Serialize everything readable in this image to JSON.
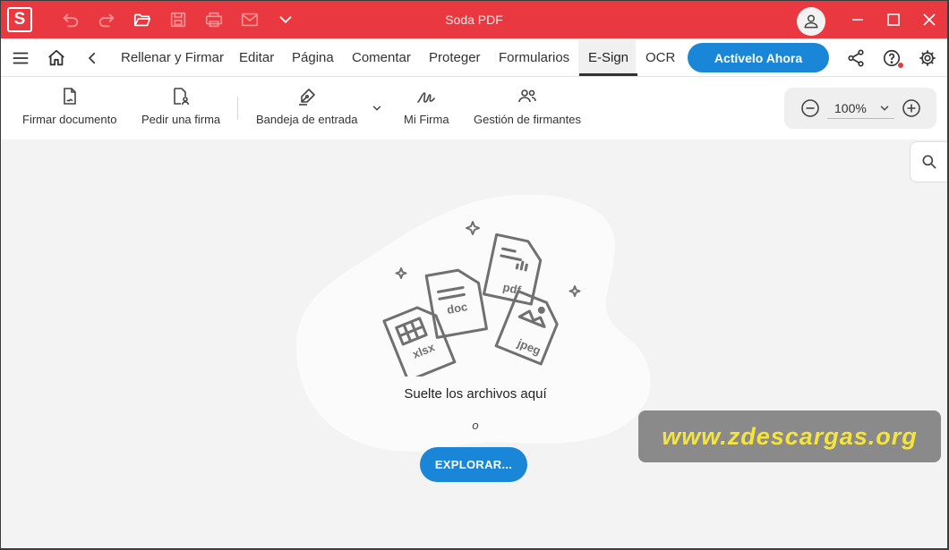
{
  "app": {
    "logo_letter": "S",
    "window_title": "Soda PDF"
  },
  "quick_access": [
    "undo-icon",
    "redo-icon",
    "open-folder-icon",
    "save-icon",
    "print-icon",
    "mail-icon",
    "chevron-down-icon"
  ],
  "menu": {
    "items": [
      {
        "label": "Rellenar y Firmar"
      },
      {
        "label": "Editar"
      },
      {
        "label": "Página"
      },
      {
        "label": "Comentar"
      },
      {
        "label": "Proteger"
      },
      {
        "label": "Formularios"
      },
      {
        "label": "E-Sign",
        "active": true
      },
      {
        "label": "OCR"
      }
    ],
    "activate_label": "Actívelo Ahora"
  },
  "toolbar": {
    "tools": [
      {
        "label": "Firmar documento",
        "icon": "sign-document-icon"
      },
      {
        "label": "Pedir una firma",
        "icon": "request-signature-icon"
      },
      {
        "label": "Bandeja de entrada",
        "icon": "pen-nib-icon"
      },
      {
        "label": "Mi Firma",
        "icon": "signature-icon"
      },
      {
        "label": "Gestión de firmantes",
        "icon": "signers-icon"
      }
    ],
    "zoom": "100%"
  },
  "workspace": {
    "drop_text": "Suelte los archivos aquí",
    "or_text": "o",
    "explore_label": "EXPLORAR...",
    "file_labels": [
      "xlsx",
      "doc",
      "pdf",
      "jpeg"
    ]
  },
  "watermark": "www.zdescargas.org",
  "colors": {
    "titlebar": "#e9383f",
    "accent_blue": "#1a86d7",
    "watermark_text": "#f5e53a"
  }
}
